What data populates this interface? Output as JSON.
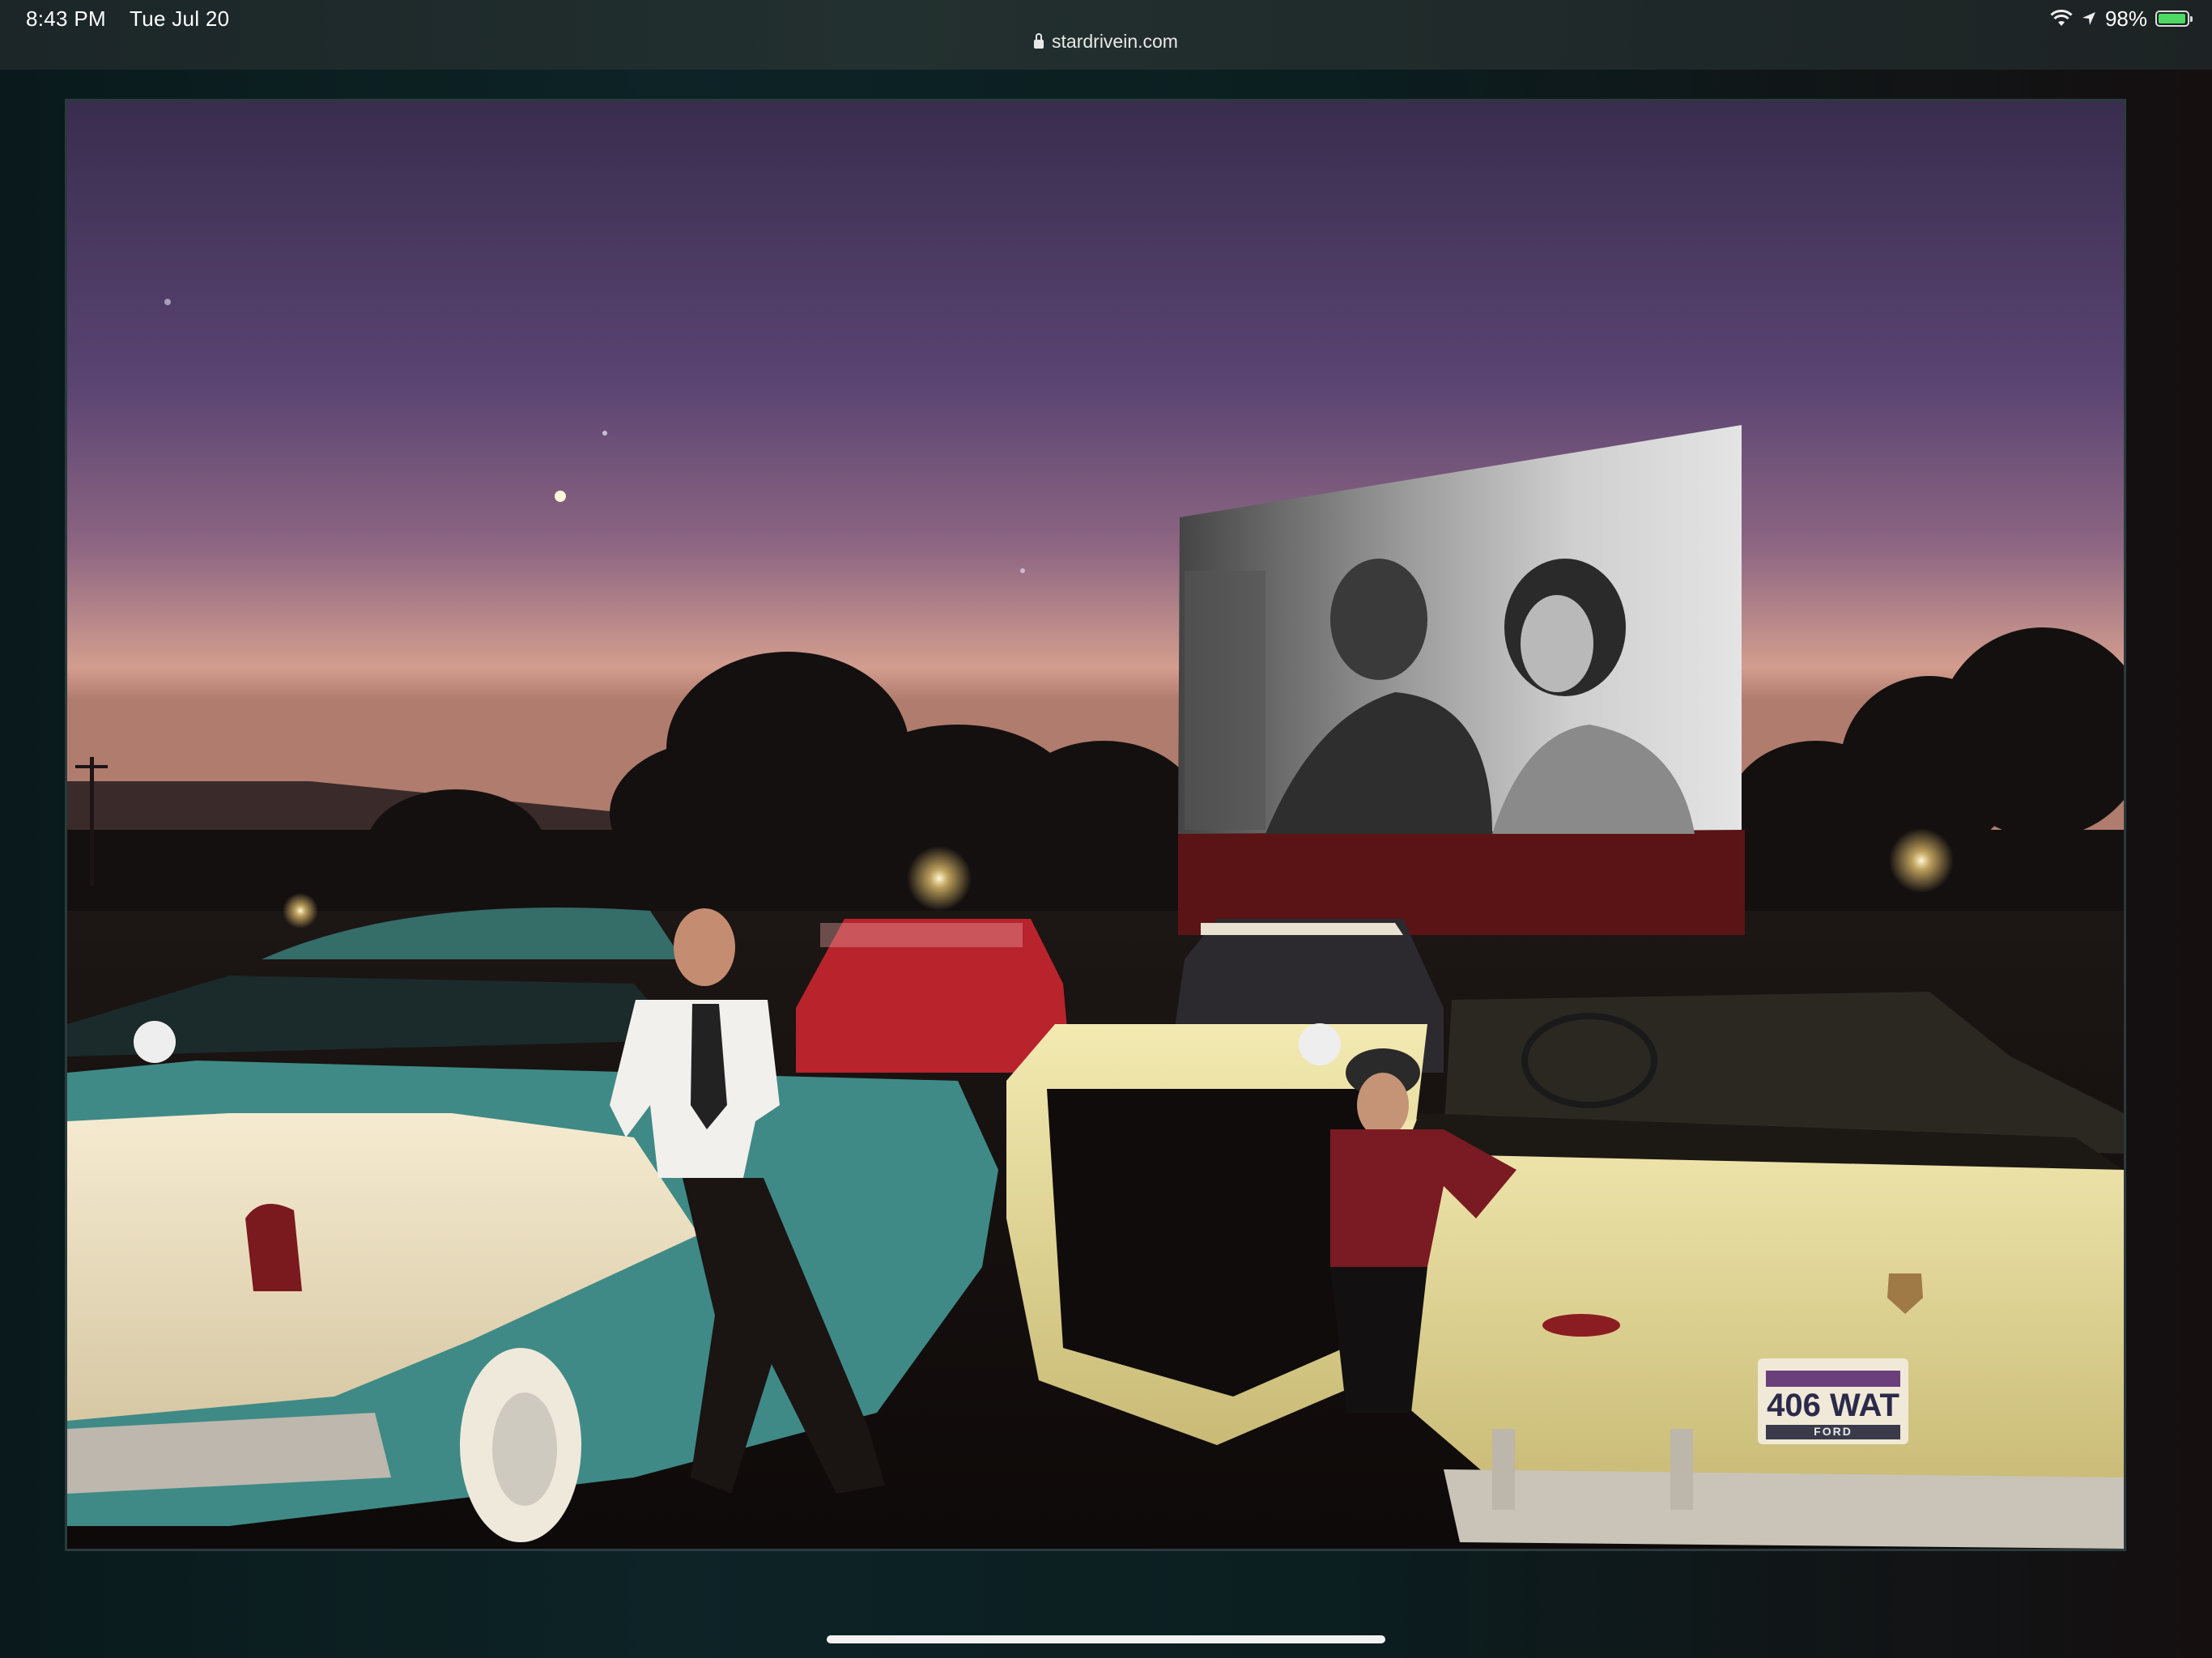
{
  "status_bar": {
    "time": "8:43 PM",
    "date": "Tue Jul 20",
    "url": "stardrivein.com",
    "battery_percent": "98%",
    "battery_level": 0.98,
    "icons": [
      "lock-icon",
      "wifi-icon",
      "location-icon",
      "battery-charging-icon"
    ]
  },
  "image": {
    "license_plate": "406 WAT",
    "plate_brand": "FORD"
  },
  "colors": {
    "sky_top": "#3b2e50",
    "sky_horizon": "#d8a291",
    "battery_green": "#4cd964"
  }
}
